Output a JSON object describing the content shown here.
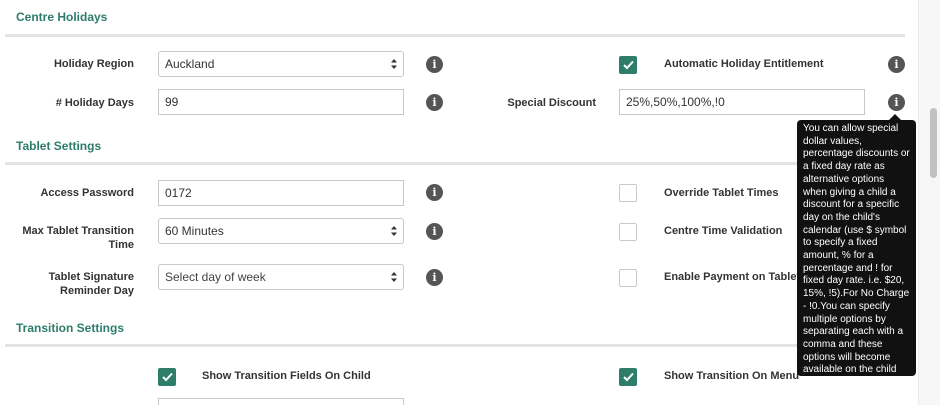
{
  "sections": {
    "centre_holidays": "Centre Holidays",
    "tablet_settings": "Tablet Settings",
    "transition_settings": "Transition Settings"
  },
  "holiday_region": {
    "label": "Holiday Region",
    "value": "Auckland"
  },
  "holiday_days": {
    "label": "# Holiday Days",
    "value": "99"
  },
  "automatic_holiday": {
    "label": "Automatic Holiday Entitlement",
    "checked": true
  },
  "special_discount": {
    "label": "Special Discount",
    "value": "25%,50%,100%,!0"
  },
  "access_password": {
    "label": "Access Password",
    "value": "0172"
  },
  "max_tablet_transition": {
    "label": "Max Tablet Transition Time",
    "value": "60 Minutes"
  },
  "tablet_signature": {
    "label": "Tablet Signature Reminder Day",
    "value": "Select day of week"
  },
  "override_tablet_times": {
    "label": "Override Tablet Times",
    "checked": false
  },
  "centre_time_validation": {
    "label": "Centre Time Validation",
    "checked": false
  },
  "enable_payment": {
    "label": "Enable Payment on Tablet",
    "checked": false
  },
  "show_transition_fields": {
    "label": "Show Transition Fields On Child",
    "checked": true
  },
  "show_transition_menu": {
    "label": "Show Transition On Menu",
    "checked": true
  },
  "tooltip": {
    "text": "You can allow special dollar values, percentage discounts or a fixed day rate as alternative options when giving a child a discount for a specific day on the child's calendar (use $ symbol to specify a fixed amount, % for a percentage and ! for fixed day rate. i.e. $20, 15%, !5).For No Charge - !0.You can specify multiple options by separating each with a comma and these options will become available on the child calendar."
  },
  "icons": {
    "info": "info-icon",
    "check": "checkmark-icon",
    "select_arrows": "select-arrows-icon"
  },
  "colors": {
    "accent": "#2e7d6b",
    "tooltip_bg": "#111111",
    "info_icon": "#555555"
  }
}
